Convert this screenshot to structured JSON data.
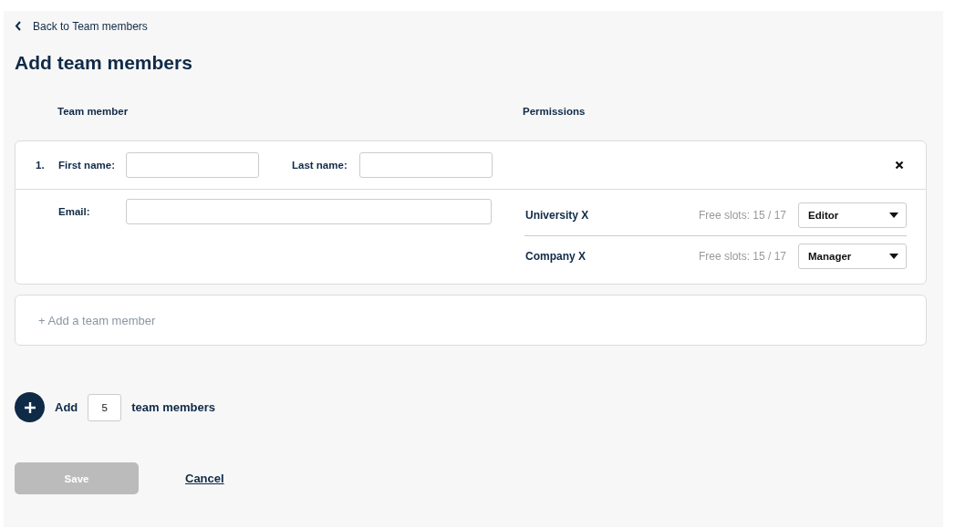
{
  "back_link": "Back to Team members",
  "title": "Add team members",
  "columns": [
    "Team member",
    "Permissions"
  ],
  "members": [
    {
      "number": "1.",
      "first_name_label": "First name:",
      "last_name_label": "Last name:",
      "email_label": "Email:",
      "permissions": [
        {
          "organization": "University X",
          "slots": "Free slots: 15 / 17",
          "role": "Editor"
        },
        {
          "organization": "Company X",
          "slots": "Free slots: 15 / 17",
          "role": "Manager"
        }
      ]
    }
  ],
  "add_member": "+ Add a team member",
  "bulk_add": {
    "prefix": "Add",
    "count": "5",
    "suffix": "team members"
  },
  "save_button": {
    "label": "Save",
    "disabled": true
  },
  "cancel_link": "Cancel"
}
